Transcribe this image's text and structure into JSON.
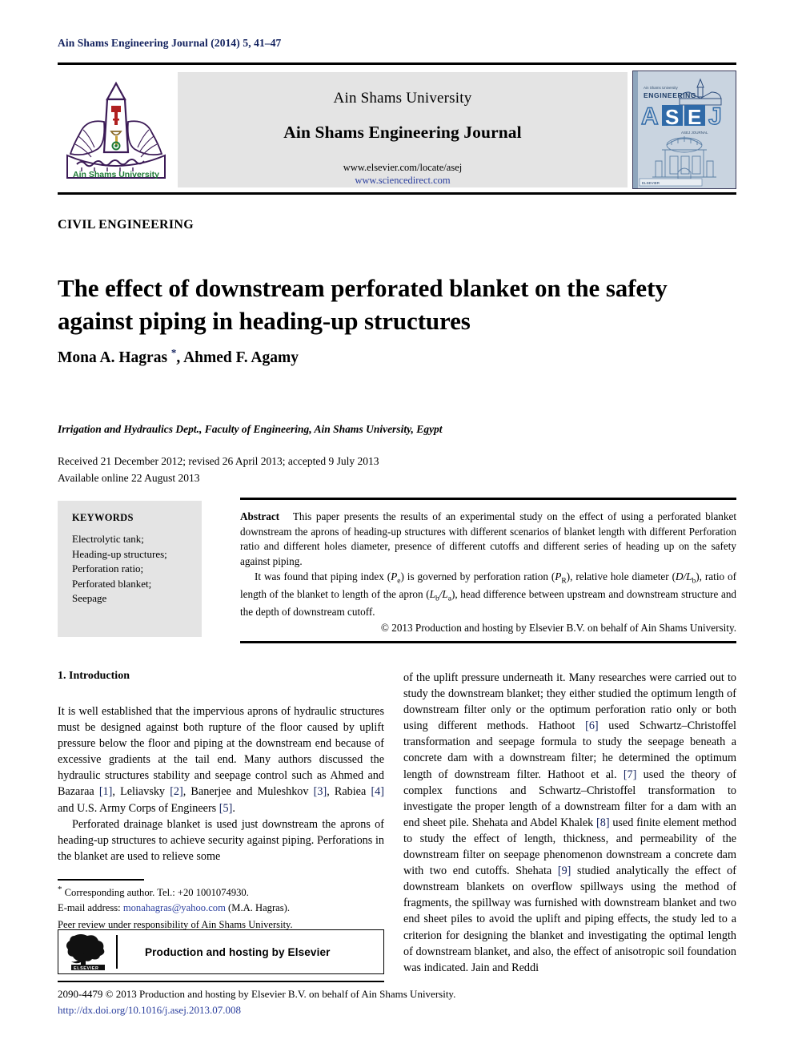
{
  "running_head": "Ain Shams Engineering Journal (2014) 5, 41–47",
  "masthead": {
    "university": "Ain Shams University",
    "journal": "Ain Shams Engineering Journal",
    "url_elsevier": "www.elsevier.com/locate/asej",
    "url_sciencedirect": "www.sciencedirect.com",
    "logo_caption_en": "Ain Shams University",
    "cover": {
      "top_small": "Ain Shams University",
      "engineering": "ENGINEERING",
      "acronym_a": "A",
      "acronym_s": "S",
      "acronym_e": "E",
      "acronym_j": "J",
      "subtitle": "ASEJ JOURNAL",
      "footer": "ELSEVIER"
    }
  },
  "section_label": "CIVIL ENGINEERING",
  "title": "The effect of downstream perforated blanket on the safety against piping in heading-up structures",
  "authors": "Mona A. Hagras , Ahmed F. Agamy",
  "author_star": "*",
  "affiliation": "Irrigation and Hydraulics Dept., Faculty of Engineering, Ain Shams University, Egypt",
  "dates": {
    "received": "Received 21 December 2012; revised 26 April 2013; accepted 9 July 2013",
    "available": "Available online 22 August 2013"
  },
  "keywords": {
    "heading": "KEYWORDS",
    "items": [
      "Electrolytic tank;",
      "Heading-up structures;",
      "Perforation ratio;",
      "Perforated blanket;",
      "Seepage"
    ]
  },
  "abstract": {
    "heading": "Abstract",
    "paragraph1": "This paper presents the results of an experimental study on the effect of using a perforated blanket downstream the aprons of heading-up structures with different scenarios of blanket length with different Perforation ratio and different holes diameter, presence of different cutoffs and different series of heading up on the safety against piping.",
    "p2_a": "It was found that piping index (",
    "p2_sym1": "P",
    "p2_sub1": "e",
    "p2_b": ") is governed by perforation ration (",
    "p2_sym2": "P",
    "p2_sub2": "R",
    "p2_c": "), relative hole diameter (",
    "p2_sym3": "D",
    "p2_sym3b": "/L",
    "p2_sub3": "b",
    "p2_d": "), ratio of length of the blanket to length of the apron (",
    "p2_sym4": "L",
    "p2_sub4": "b",
    "p2_sym4b": "/L",
    "p2_sub4b": "a",
    "p2_e": "), head difference between upstream and downstream structure and the depth of downstream cutoff.",
    "copyright": "© 2013 Production and hosting by Elsevier B.V. on behalf of Ain Shams University."
  },
  "intro": {
    "heading": "1. Introduction",
    "left_p1_a": "It is well established that the impervious aprons of hydraulic structures must be designed against both rupture of the floor caused by uplift pressure below the floor and piping at the downstream end because of excessive gradients at the tail end. Many authors discussed the hydraulic structures stability and seepage control such as Ahmed and Bazaraa ",
    "ref1": "[1]",
    "left_p1_b": ", Leliavsky ",
    "ref2": "[2]",
    "left_p1_c": ", Banerjee and Muleshkov ",
    "ref3": "[3]",
    "left_p1_d": ", Rabiea ",
    "ref4": "[4]",
    "left_p1_e": " and U.S. Army Corps of Engineers ",
    "ref5": "[5]",
    "left_p1_f": ".",
    "left_p2": "Perforated drainage blanket is used just downstream the aprons of heading-up structures to achieve security against piping. Perforations in the blanket are used to relieve some",
    "right_a": "of the uplift pressure underneath it. Many researches were carried out to study the downstream blanket; they either studied the optimum length of downstream filter only or the optimum perforation ratio only or both using different methods. Hathoot ",
    "ref6": "[6]",
    "right_b": " used Schwartz–Christoffel transformation and seepage formula to study the seepage beneath a concrete dam with a downstream filter; he determined the optimum length of downstream filter. Hathoot et al. ",
    "ref7": "[7]",
    "right_c": " used the theory of complex functions and Schwartz–Christoffel transformation to investigate the proper length of a downstream filter for a dam with an end sheet pile. Shehata and Abdel Khalek ",
    "ref8": "[8]",
    "right_d": " used finite element method to study the effect of length, thickness, and permeability of the downstream filter on seepage phenomenon downstream a concrete dam with two end cutoffs. Shehata ",
    "ref9": "[9]",
    "right_e": " studied analytically the effect of downstream blankets on overflow spillways using the method of fragments, the spillway was furnished with downstream blanket and two end sheet piles to avoid the uplift and piping effects, the study led to a criterion for designing the blanket and investigating the optimal length of downstream blanket, and also, the effect of anisotropic soil foundation was indicated. Jain and Reddi"
  },
  "footnotes": {
    "corresponding": "Corresponding author. Tel.: +20 1001074930.",
    "email_label": "E-mail address: ",
    "email": "monahagras@yahoo.com",
    "email_suffix": " (M.A. Hagras).",
    "peer_review": "Peer review under responsibility of Ain Shams University."
  },
  "elsevier_box": {
    "text": "Production and hosting by Elsevier",
    "logo_label": "ELSEVIER"
  },
  "footer": {
    "issn_line": "2090-4479 © 2013 Production and hosting by Elsevier B.V. on behalf of Ain Shams University.",
    "doi": "http://dx.doi.org/10.1016/j.asej.2013.07.008"
  },
  "colors": {
    "link_blue": "#2b3f9e",
    "header_navy": "#12215e",
    "panel_gray": "#e4e4e4"
  }
}
